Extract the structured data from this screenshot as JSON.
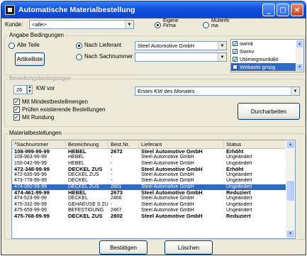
{
  "window": {
    "title": "Automatische Materialbestellung",
    "minimize": "_",
    "maximize": "□",
    "close": "×"
  },
  "kunde": {
    "label": "Kunde:",
    "value": "<alle>",
    "radio_eigene": "Eigene\nFirma",
    "radio_mutter": "Mutterfir\nma"
  },
  "angabe": {
    "title": "Angabe Bedingungen",
    "alle_teile": "Alle Teile",
    "nach_lieferant": "Nach Lieferant",
    "nach_sachnummer": "Nach Sachnummer",
    "artikelliste": "Artikelliste",
    "lieferant_value": "Steel Automotive GmbH",
    "sachnummer_value": ""
  },
  "suppliers": [
    {
      "name": "swmk",
      "checked": true,
      "selected": false
    },
    {
      "name": "Swmv",
      "checked": true,
      "selected": false
    },
    {
      "name": "Utómegmunkáló",
      "checked": true,
      "selected": false
    },
    {
      "name": "Webasto gmpg",
      "checked": true,
      "selected": true
    }
  ],
  "bestellung": {
    "title": "Bestellungsbedingungen",
    "kw_value": "26",
    "kw_label": "KW vor",
    "erstes": "Erstes KW des Monates",
    "mindest": "Mit Mindestbestellmengen",
    "pruefen": "Prüfen existierende Bestellungen",
    "rundung": "Mit Rundung",
    "durcharbeiten": "Durcharbeiten"
  },
  "material": {
    "title": "Materialbestellungen",
    "columns": [
      "^Sachnummer",
      "Bezeichnung",
      "Best.Nr.",
      "Lieferant",
      "Status"
    ]
  },
  "rows": [
    {
      "sach": "108-999-99-99",
      "bez": "HEBEL",
      "nr": "2672",
      "lief": "Steel Automotive GmbH",
      "status": "Erhöht",
      "bold": true,
      "sel": false
    },
    {
      "sach": "109-963-99-99",
      "bez": "HEBEL",
      "nr": "-",
      "lief": "Steel Automotive GmbH",
      "status": "Ungeändert",
      "bold": false,
      "sel": false
    },
    {
      "sach": "150-042-99-99",
      "bez": "HEBEL",
      "nr": "-",
      "lief": "Steel Automotive GmbH",
      "status": "Ungeändert",
      "bold": false,
      "sel": false
    },
    {
      "sach": "472-348-99-99",
      "bez": "DECKEL ZUS",
      "nr": "-",
      "lief": "Steel Automotive GmbH",
      "status": "Erhöht",
      "bold": true,
      "sel": false
    },
    {
      "sach": "472-635-99-99",
      "bez": "DECKEL ZUS",
      "nr": "-",
      "lief": "Steel Automotive GmbH",
      "status": "Ungeändert",
      "bold": false,
      "sel": false
    },
    {
      "sach": "473-778-99-99",
      "bez": "DECKEL",
      "nr": "-",
      "lief": "Steel Automotive GmbH",
      "status": "Ungeändert",
      "bold": false,
      "sel": false
    },
    {
      "sach": "474-060-99-99",
      "bez": "DECKEL ZUS",
      "nr": "2801",
      "lief": "Steel Automotive GmbH",
      "status": "Ungeändert",
      "bold": false,
      "sel": true
    },
    {
      "sach": "474-461-99-99",
      "bez": "HEBEL",
      "nr": "2673",
      "lief": "Steel Automotive GmbH",
      "status": "Reduziert",
      "bold": true,
      "sel": false
    },
    {
      "sach": "474-523-99-99",
      "bez": "DECKEL",
      "nr": "2466",
      "lief": "Steel Automotive GmbH",
      "status": "Ungeändert",
      "bold": false,
      "sel": false
    },
    {
      "sach": "475-332-99-99",
      "bez": "GEHÄEUSE S ZUS",
      "nr": "-",
      "lief": "Steel Automotive GmbH",
      "status": "Ungeändert",
      "bold": false,
      "sel": false
    },
    {
      "sach": "475-659-99-99",
      "bez": "BEFESTIGUNG",
      "nr": "2467",
      "lief": "Steel Automotive GmbH",
      "status": "Ungeändert",
      "bold": false,
      "sel": false
    },
    {
      "sach": "475-768-99-99",
      "bez": "DECKEL ZUS",
      "nr": "2802",
      "lief": "Steel Automotive GmbH",
      "status": "Reduziert",
      "bold": true,
      "sel": false
    }
  ],
  "footer": {
    "bestatigen": "Bestätigen",
    "loeschen": "Löschen"
  }
}
